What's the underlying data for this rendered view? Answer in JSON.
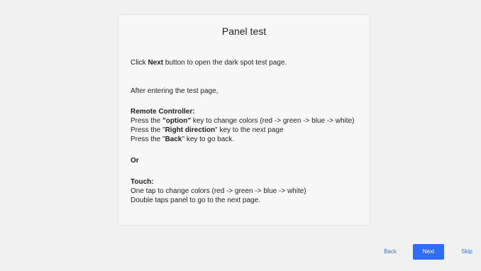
{
  "panel": {
    "title": "Panel test",
    "intro": {
      "pre": "Click ",
      "bold": "Next",
      "post": " button to open the dark spot test page."
    },
    "after_entering": "After entering the test page,",
    "remote_heading": "Remote Controller:",
    "remote_lines": [
      {
        "pre": "Press the ",
        "bold": "\"option\"",
        "post": " key to change colors (red -> green -> blue -> white)"
      },
      {
        "pre": "Press the \"",
        "bold": "Right direction",
        "post": "\" key to the next page"
      },
      {
        "pre": "Press the \"",
        "bold": "Back",
        "post": "\" key to go back."
      }
    ],
    "or_label": "Or",
    "touch_heading": "Touch:",
    "touch_lines": [
      "One tap to change colors (red -> green -> blue -> white)",
      "Double taps panel to go to the next page."
    ]
  },
  "footer": {
    "back_label": "Back",
    "next_label": "Next",
    "skip_label": "Skip"
  },
  "colors": {
    "accent": "#2f6df6",
    "link": "#3a6fd8"
  }
}
